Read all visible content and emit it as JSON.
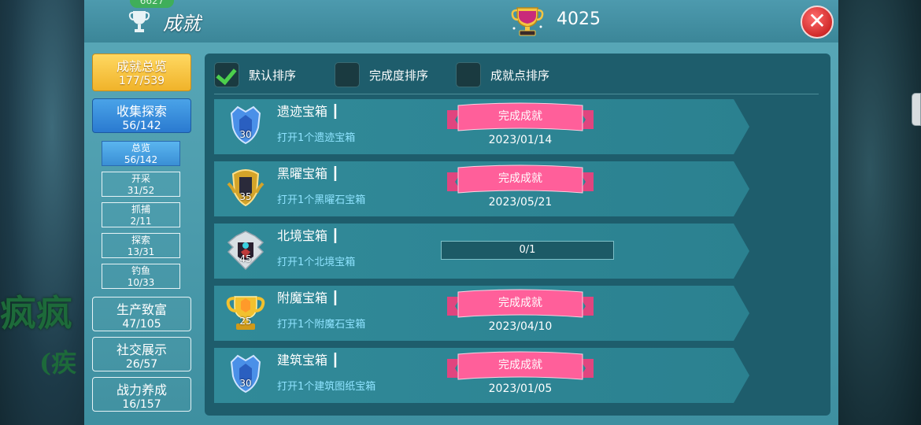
{
  "header": {
    "badge": "6627",
    "title": "成就",
    "points": "4025",
    "close_label": "✕"
  },
  "background": {
    "text1": "疯疯",
    "text2": "(疾"
  },
  "nav": {
    "main": [
      {
        "label": "成就总览",
        "count": "177/539",
        "style": "gold"
      },
      {
        "label": "收集探索",
        "count": "56/142",
        "style": "blue"
      }
    ],
    "sub": [
      {
        "label": "总览",
        "count": "56/142",
        "active": true
      },
      {
        "label": "开采",
        "count": "31/52"
      },
      {
        "label": "抓捕",
        "count": "2/11"
      },
      {
        "label": "探索",
        "count": "13/31"
      },
      {
        "label": "钓鱼",
        "count": "10/33"
      }
    ],
    "more": [
      {
        "label": "生产致富",
        "count": "47/105"
      },
      {
        "label": "社交展示",
        "count": "26/57"
      },
      {
        "label": "战力养成",
        "count": "16/157"
      }
    ]
  },
  "sort": {
    "default": "默认排序",
    "completion": "完成度排序",
    "points": "成就点排序",
    "selected": "default"
  },
  "achievements": [
    {
      "title": "遗迹宝箱",
      "desc": "打开1个遗迹宝箱",
      "points": "30",
      "status": "完成成就",
      "date": "2023/01/14",
      "icon": "blue-crown-icon"
    },
    {
      "title": "黑曜宝箱",
      "desc": "打开1个黑曜石宝箱",
      "points": "35",
      "status": "完成成就",
      "date": "2023/05/21",
      "icon": "gold-shield-icon"
    },
    {
      "title": "北境宝箱",
      "desc": "打开1个北境宝箱",
      "points": "45",
      "progress": "0/1",
      "icon": "dark-crest-icon"
    },
    {
      "title": "附魔宝箱",
      "desc": "打开1个附魔石宝箱",
      "points": "25",
      "status": "完成成就",
      "date": "2023/04/10",
      "icon": "gold-trophy-icon"
    },
    {
      "title": "建筑宝箱",
      "desc": "打开1个建筑图纸宝箱",
      "points": "30",
      "status": "完成成就",
      "date": "2023/01/05",
      "icon": "blue-crown-icon"
    }
  ],
  "colors": {
    "ribbon": "#ff5f9a",
    "desc_text": "#8fe3ff",
    "panel": "#1e5d6c"
  }
}
